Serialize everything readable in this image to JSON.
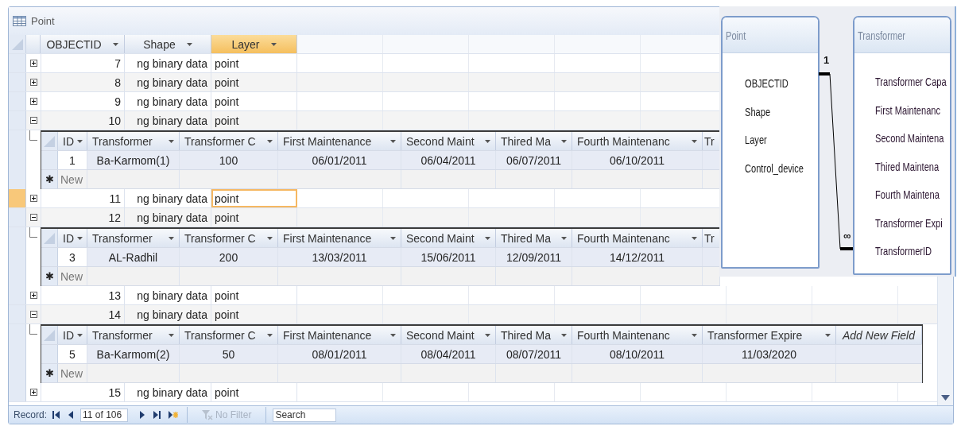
{
  "window": {
    "title": "Point"
  },
  "columns": [
    {
      "label": "OBJECTID",
      "selected": false
    },
    {
      "label": "Shape",
      "selected": false
    },
    {
      "label": "Layer",
      "selected": true
    }
  ],
  "rows": [
    {
      "objectid": "7",
      "shape": "ng binary data",
      "layer": "point",
      "expanded": false,
      "selected": false
    },
    {
      "objectid": "8",
      "shape": "ng binary data",
      "layer": "point",
      "expanded": false,
      "selected": false
    },
    {
      "objectid": "9",
      "shape": "ng binary data",
      "layer": "point",
      "expanded": false,
      "selected": false
    },
    {
      "objectid": "10",
      "shape": "ng binary data",
      "layer": "point",
      "expanded": true,
      "selected": false,
      "subsheet": {
        "columns": [
          {
            "label": "ID",
            "kind": "field"
          },
          {
            "label": "Transformer",
            "kind": "field"
          },
          {
            "label": "Transformer C",
            "kind": "field"
          },
          {
            "label": "First Maintenance",
            "kind": "field"
          },
          {
            "label": "Second Maint",
            "kind": "field"
          },
          {
            "label": "Thired Ma",
            "kind": "field"
          },
          {
            "label": "Fourth Maintenanc",
            "kind": "field"
          },
          {
            "label": "Tr",
            "kind": "cut"
          }
        ],
        "rows": [
          [
            "1",
            "Ba-Karmom(1)",
            "100",
            "06/01/2011",
            "06/04/2011",
            "06/07/2011",
            "06/10/2011"
          ]
        ],
        "new_row": {
          "marker": "✱",
          "label": "New"
        }
      }
    },
    {
      "objectid": "11",
      "shape": "ng binary data",
      "layer": "point",
      "expanded": false,
      "selected": true
    },
    {
      "objectid": "12",
      "shape": "ng binary data",
      "layer": "point",
      "expanded": true,
      "selected": false,
      "subsheet": {
        "columns": [
          {
            "label": "ID",
            "kind": "field"
          },
          {
            "label": "Transformer",
            "kind": "field"
          },
          {
            "label": "Transformer C",
            "kind": "field"
          },
          {
            "label": "First Maintenance",
            "kind": "field"
          },
          {
            "label": "Second Maint",
            "kind": "field"
          },
          {
            "label": "Thired Ma",
            "kind": "field"
          },
          {
            "label": "Fourth Maintenanc",
            "kind": "field"
          },
          {
            "label": "Tr",
            "kind": "cut"
          }
        ],
        "rows": [
          [
            "3",
            "AL-Radhil",
            "200",
            "13/03/2011",
            "15/06/2011",
            "12/09/2011",
            "14/12/2011"
          ]
        ],
        "new_row": {
          "marker": "✱",
          "label": "New"
        }
      }
    },
    {
      "objectid": "13",
      "shape": "ng binary data",
      "layer": "point",
      "expanded": false,
      "selected": false
    },
    {
      "objectid": "14",
      "shape": "ng binary data",
      "layer": "point",
      "expanded": true,
      "selected": false,
      "subsheet": {
        "columns": [
          {
            "label": "ID",
            "kind": "field"
          },
          {
            "label": "Transformer",
            "kind": "field"
          },
          {
            "label": "Transformer C",
            "kind": "field"
          },
          {
            "label": "First Maintenance",
            "kind": "field"
          },
          {
            "label": "Second Maint",
            "kind": "field"
          },
          {
            "label": "Thired Ma",
            "kind": "field"
          },
          {
            "label": "Fourth Maintenanc",
            "kind": "field"
          },
          {
            "label": "Transformer Expire",
            "kind": "field"
          },
          {
            "label": "Add New Field",
            "kind": "add"
          }
        ],
        "rows": [
          [
            "5",
            "Ba-Karmom(2)",
            "50",
            "08/01/2011",
            "08/04/2011",
            "08/07/2011",
            "08/10/2011",
            "11/03/2020"
          ]
        ],
        "new_row": {
          "marker": "✱",
          "label": "New"
        }
      }
    },
    {
      "objectid": "15",
      "shape": "ng binary data",
      "layer": "point",
      "expanded": false,
      "selected": false
    }
  ],
  "status_bar": {
    "record_label": "Record:",
    "record_value": "11 of 106",
    "filter": {
      "label": "No Filter",
      "disabled": true
    },
    "search": {
      "placeholder": "Search"
    }
  },
  "relationships": {
    "tables": [
      {
        "title": "Point",
        "fields": [
          "OBJECTID",
          "Shape",
          "Layer",
          "Control_device"
        ]
      },
      {
        "title": "Transformer",
        "fields": [
          "Transformer Capa",
          "First Maintenanc",
          "Second Maintena",
          "Thired Maintena",
          "Fourth Maintena",
          "Transformer Expi",
          "TransformerID"
        ]
      }
    ],
    "one_label": "1",
    "many_label": "∞"
  }
}
